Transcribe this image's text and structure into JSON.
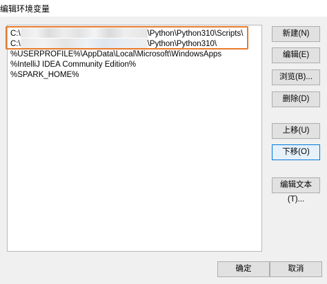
{
  "window": {
    "title": "编辑环境变量"
  },
  "path_list": {
    "items": [
      {
        "prefix": "C:\\",
        "suffix": "\\Python\\Python310\\Scripts\\"
      },
      {
        "prefix": "C:\\",
        "suffix": "\\Python\\Python310\\"
      },
      {
        "prefix": "",
        "suffix": "%USERPROFILE%\\AppData\\Local\\Microsoft\\WindowsApps"
      },
      {
        "prefix": "",
        "suffix": "%IntelliJ IDEA Community Edition%"
      },
      {
        "prefix": "",
        "suffix": "%SPARK_HOME%"
      }
    ]
  },
  "buttons": {
    "new": "新建(N)",
    "edit": "编辑(E)",
    "browse": "浏览(B)...",
    "delete": "删除(D)",
    "move_up": "上移(U)",
    "move_down": "下移(O)",
    "edit_text": "编辑文本(T)...",
    "ok": "确定",
    "cancel": "取消"
  },
  "colors": {
    "highlight_border": "#e8792a",
    "focus_border": "#0078d7"
  }
}
